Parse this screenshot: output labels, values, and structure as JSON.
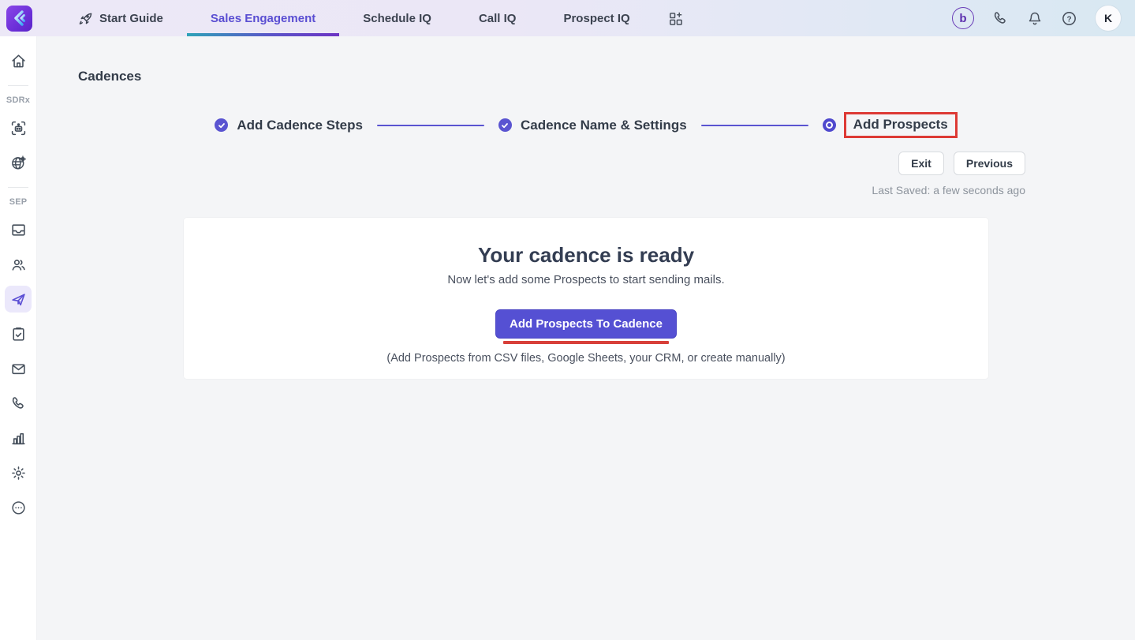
{
  "topbar": {
    "tabs": [
      {
        "label": "Start Guide"
      },
      {
        "label": "Sales Engagement"
      },
      {
        "label": "Schedule IQ"
      },
      {
        "label": "Call IQ"
      },
      {
        "label": "Prospect IQ"
      }
    ],
    "b_badge": "b",
    "avatar_initial": "K"
  },
  "sidebar": {
    "sections": {
      "sdrx": "SDRx",
      "sep": "SEP"
    }
  },
  "page": {
    "title": "Cadences",
    "stepper": {
      "step1": "Add Cadence Steps",
      "step2": "Cadence Name & Settings",
      "step3": "Add Prospects"
    },
    "actions": {
      "exit": "Exit",
      "previous": "Previous"
    },
    "last_saved": "Last Saved: a few seconds ago",
    "card": {
      "title": "Your cadence is ready",
      "subtitle": "Now let's add some Prospects to start sending mails.",
      "cta": "Add Prospects To Cadence",
      "hint": "(Add Prospects from CSV files, Google Sheets, your CRM, or create manually)"
    }
  },
  "colors": {
    "accent_purple": "#5550d3",
    "stepper_purple": "#5a54d1",
    "annotation_red": "#dd3a35",
    "content_bg": "#f4f5f7",
    "topbar_left": "#ece8f7",
    "topbar_right": "#d8e8f2"
  }
}
